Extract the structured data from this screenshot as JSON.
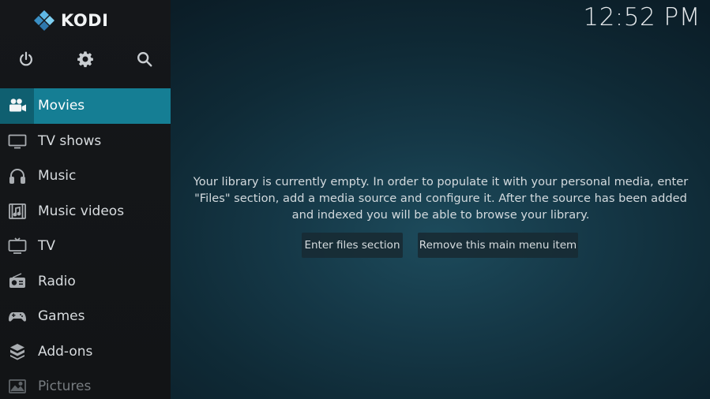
{
  "app": {
    "logo_text": "KODI",
    "clock": "12:52 PM"
  },
  "top_icons": [
    {
      "name": "power-icon"
    },
    {
      "name": "gear-icon"
    },
    {
      "name": "search-icon"
    }
  ],
  "menu": {
    "items": [
      {
        "label": "Movies",
        "icon": "movie-camera-icon",
        "state": "active"
      },
      {
        "label": "TV shows",
        "icon": "tv-icon",
        "state": "normal"
      },
      {
        "label": "Music",
        "icon": "headphones-icon",
        "state": "normal"
      },
      {
        "label": "Music videos",
        "icon": "music-video-icon",
        "state": "normal"
      },
      {
        "label": "TV",
        "icon": "tv-screen-icon",
        "state": "normal"
      },
      {
        "label": "Radio",
        "icon": "radio-icon",
        "state": "normal"
      },
      {
        "label": "Games",
        "icon": "gamepad-icon",
        "state": "normal"
      },
      {
        "label": "Add-ons",
        "icon": "addons-box-icon",
        "state": "normal"
      },
      {
        "label": "Pictures",
        "icon": "pictures-icon",
        "state": "dim"
      }
    ]
  },
  "content": {
    "message": "Your library is currently empty. In order to populate it with your personal media, enter \"Files\" section, add a media source and configure it. After the source has been added and indexed you will be able to browse your library.",
    "buttons": {
      "enter_files": "Enter files section",
      "remove_item": "Remove this main menu item"
    }
  },
  "colors": {
    "accent": "#157e94",
    "accent_dark": "#0f5f70",
    "sidebar_bg": "#15171a",
    "background": "#153847"
  }
}
